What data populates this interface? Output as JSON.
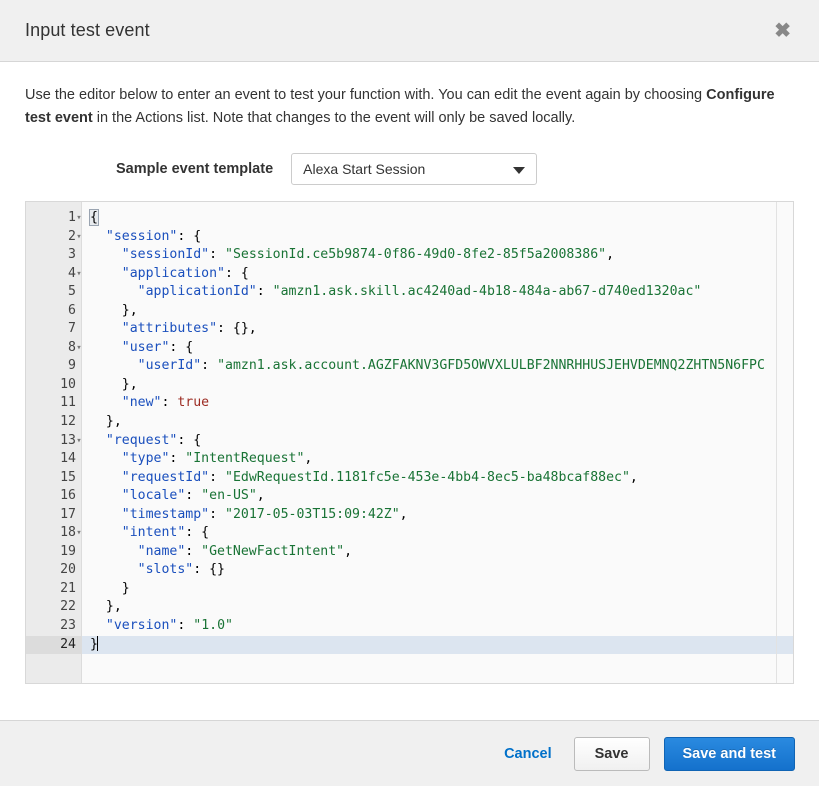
{
  "header": {
    "title": "Input test event",
    "close_label": "✖"
  },
  "body": {
    "description_part1": "Use the editor below to enter an event to test your function with. You can edit the event again by choosing ",
    "description_bold1": "Configure test event",
    "description_part2": " in the Actions list. Note that changes to the event will only be saved locally.",
    "template_label": "Sample event template",
    "template_selected": "Alexa Start Session",
    "template_options": [
      "Alexa Start Session"
    ]
  },
  "editor": {
    "active_line": 24,
    "lines": [
      {
        "n": 1,
        "fold": true,
        "indent": 0,
        "tokens": [
          {
            "t": "punc",
            "v": "{"
          }
        ],
        "selected_brace": true
      },
      {
        "n": 2,
        "fold": true,
        "indent": 1,
        "tokens": [
          {
            "t": "key",
            "v": "\"session\""
          },
          {
            "t": "punc",
            "v": ": {"
          }
        ]
      },
      {
        "n": 3,
        "fold": false,
        "indent": 2,
        "tokens": [
          {
            "t": "key",
            "v": "\"sessionId\""
          },
          {
            "t": "punc",
            "v": ": "
          },
          {
            "t": "str",
            "v": "\"SessionId.ce5b9874-0f86-49d0-8fe2-85f5a2008386\""
          },
          {
            "t": "punc",
            "v": ","
          }
        ]
      },
      {
        "n": 4,
        "fold": true,
        "indent": 2,
        "tokens": [
          {
            "t": "key",
            "v": "\"application\""
          },
          {
            "t": "punc",
            "v": ": {"
          }
        ]
      },
      {
        "n": 5,
        "fold": false,
        "indent": 3,
        "tokens": [
          {
            "t": "key",
            "v": "\"applicationId\""
          },
          {
            "t": "punc",
            "v": ": "
          },
          {
            "t": "str",
            "v": "\"amzn1.ask.skill.ac4240ad-4b18-484a-ab67-d740ed1320ac\""
          }
        ]
      },
      {
        "n": 6,
        "fold": false,
        "indent": 2,
        "tokens": [
          {
            "t": "punc",
            "v": "},"
          }
        ]
      },
      {
        "n": 7,
        "fold": false,
        "indent": 2,
        "tokens": [
          {
            "t": "key",
            "v": "\"attributes\""
          },
          {
            "t": "punc",
            "v": ": {},"
          }
        ]
      },
      {
        "n": 8,
        "fold": true,
        "indent": 2,
        "tokens": [
          {
            "t": "key",
            "v": "\"user\""
          },
          {
            "t": "punc",
            "v": ": {"
          }
        ]
      },
      {
        "n": 9,
        "fold": false,
        "indent": 3,
        "tokens": [
          {
            "t": "key",
            "v": "\"userId\""
          },
          {
            "t": "punc",
            "v": ": "
          },
          {
            "t": "str",
            "v": "\"amzn1.ask.account.AGZFAKNV3GFD5OWVXLULBF2NNRHHUSJEHVDEMNQ2ZHTN5N6FPC"
          }
        ]
      },
      {
        "n": 10,
        "fold": false,
        "indent": 2,
        "tokens": [
          {
            "t": "punc",
            "v": "},"
          }
        ]
      },
      {
        "n": 11,
        "fold": false,
        "indent": 2,
        "tokens": [
          {
            "t": "key",
            "v": "\"new\""
          },
          {
            "t": "punc",
            "v": ": "
          },
          {
            "t": "bool",
            "v": "true"
          }
        ]
      },
      {
        "n": 12,
        "fold": false,
        "indent": 1,
        "tokens": [
          {
            "t": "punc",
            "v": "},"
          }
        ]
      },
      {
        "n": 13,
        "fold": true,
        "indent": 1,
        "tokens": [
          {
            "t": "key",
            "v": "\"request\""
          },
          {
            "t": "punc",
            "v": ": {"
          }
        ]
      },
      {
        "n": 14,
        "fold": false,
        "indent": 2,
        "tokens": [
          {
            "t": "key",
            "v": "\"type\""
          },
          {
            "t": "punc",
            "v": ": "
          },
          {
            "t": "str",
            "v": "\"IntentRequest\""
          },
          {
            "t": "punc",
            "v": ","
          }
        ]
      },
      {
        "n": 15,
        "fold": false,
        "indent": 2,
        "tokens": [
          {
            "t": "key",
            "v": "\"requestId\""
          },
          {
            "t": "punc",
            "v": ": "
          },
          {
            "t": "str",
            "v": "\"EdwRequestId.1181fc5e-453e-4bb4-8ec5-ba48bcaf88ec\""
          },
          {
            "t": "punc",
            "v": ","
          }
        ]
      },
      {
        "n": 16,
        "fold": false,
        "indent": 2,
        "tokens": [
          {
            "t": "key",
            "v": "\"locale\""
          },
          {
            "t": "punc",
            "v": ": "
          },
          {
            "t": "str",
            "v": "\"en-US\""
          },
          {
            "t": "punc",
            "v": ","
          }
        ]
      },
      {
        "n": 17,
        "fold": false,
        "indent": 2,
        "tokens": [
          {
            "t": "key",
            "v": "\"timestamp\""
          },
          {
            "t": "punc",
            "v": ": "
          },
          {
            "t": "str",
            "v": "\"2017-05-03T15:09:42Z\""
          },
          {
            "t": "punc",
            "v": ","
          }
        ]
      },
      {
        "n": 18,
        "fold": true,
        "indent": 2,
        "tokens": [
          {
            "t": "key",
            "v": "\"intent\""
          },
          {
            "t": "punc",
            "v": ": {"
          }
        ]
      },
      {
        "n": 19,
        "fold": false,
        "indent": 3,
        "tokens": [
          {
            "t": "key",
            "v": "\"name\""
          },
          {
            "t": "punc",
            "v": ": "
          },
          {
            "t": "str",
            "v": "\"GetNewFactIntent\""
          },
          {
            "t": "punc",
            "v": ","
          }
        ]
      },
      {
        "n": 20,
        "fold": false,
        "indent": 3,
        "tokens": [
          {
            "t": "key",
            "v": "\"slots\""
          },
          {
            "t": "punc",
            "v": ": {}"
          }
        ]
      },
      {
        "n": 21,
        "fold": false,
        "indent": 2,
        "tokens": [
          {
            "t": "punc",
            "v": "}"
          }
        ]
      },
      {
        "n": 22,
        "fold": false,
        "indent": 1,
        "tokens": [
          {
            "t": "punc",
            "v": "},"
          }
        ]
      },
      {
        "n": 23,
        "fold": false,
        "indent": 1,
        "tokens": [
          {
            "t": "key",
            "v": "\"version\""
          },
          {
            "t": "punc",
            "v": ": "
          },
          {
            "t": "str",
            "v": "\"1.0\""
          }
        ]
      },
      {
        "n": 24,
        "fold": false,
        "indent": 0,
        "tokens": [
          {
            "t": "punc",
            "v": "}"
          }
        ],
        "cursor": true
      }
    ]
  },
  "footer": {
    "cancel_label": "Cancel",
    "save_label": "Save",
    "save_and_test_label": "Save and test"
  },
  "colors": {
    "accent_blue": "#1471cc",
    "link_blue": "#0070c9",
    "key_blue": "#1a4fbd",
    "string_green": "#197335",
    "bool_red": "#9c2b22",
    "header_bg": "#f0f0f0",
    "editor_bg": "#fafafa",
    "gutter_bg": "#ebebeb",
    "active_line_bg": "#dce5f0"
  }
}
